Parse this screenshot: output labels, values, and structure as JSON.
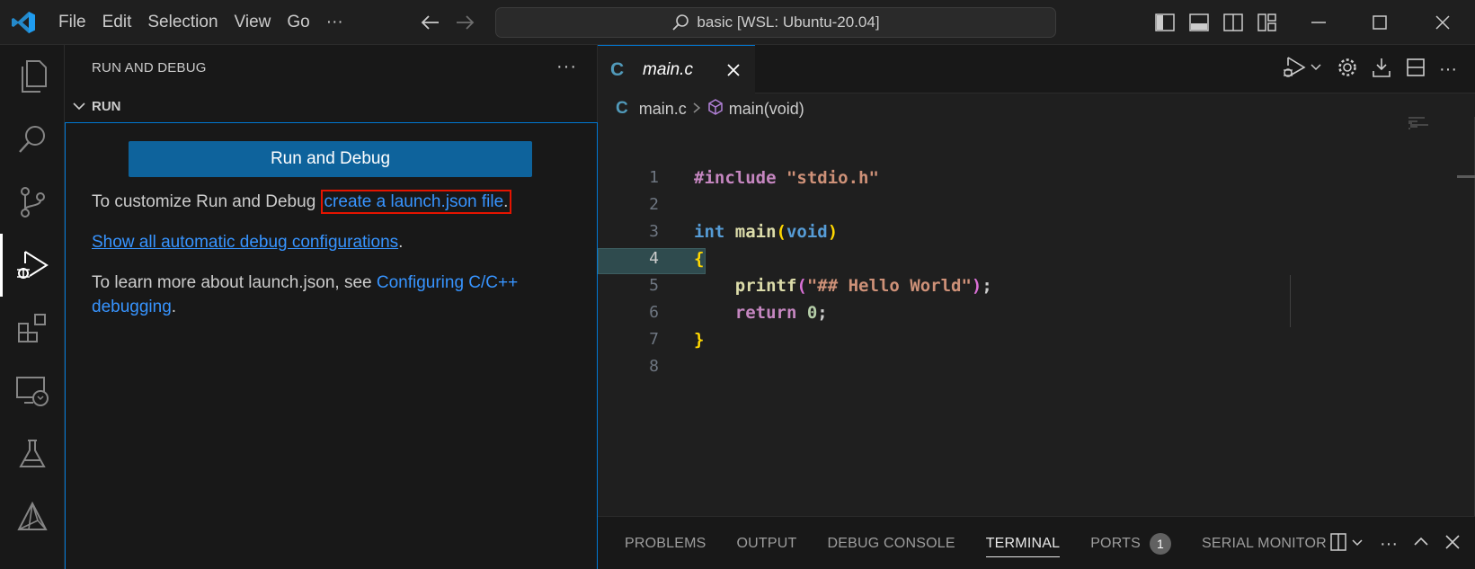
{
  "titlebar": {
    "menu": [
      "File",
      "Edit",
      "Selection",
      "View",
      "Go",
      "···"
    ],
    "command_center": "basic [WSL: Ubuntu-20.04]"
  },
  "sidebar": {
    "title": "RUN AND DEBUG",
    "more": "···",
    "section": "RUN",
    "run_button": "Run and Debug",
    "customize_prefix": "To customize Run and Debug ",
    "create_link": "create a launch.json file",
    "customize_suffix": ".",
    "show_all_link": "Show all automatic debug configurations",
    "show_all_suffix": ".",
    "learn_prefix": "To learn more about launch.json, see ",
    "learn_link": "Configuring C/C++ debugging",
    "learn_suffix": "."
  },
  "editor": {
    "tab": {
      "icon": "C",
      "name": "main.c"
    },
    "breadcrumb": {
      "icon": "C",
      "file": "main.c",
      "symbol": "main(void)"
    },
    "current_line": "4",
    "lines": [
      {
        "num": "1",
        "tokens": [
          [
            "pre",
            "#include "
          ],
          [
            "str",
            "\"stdio.h\""
          ]
        ]
      },
      {
        "num": "2",
        "tokens": []
      },
      {
        "num": "3",
        "tokens": [
          [
            "type",
            "int "
          ],
          [
            "fn",
            "main"
          ],
          [
            "br1",
            "("
          ],
          [
            "type",
            "void"
          ],
          [
            "br1",
            ")"
          ]
        ]
      },
      {
        "num": "4",
        "tokens": [
          [
            "br1",
            "{"
          ]
        ]
      },
      {
        "num": "5",
        "tokens": [
          [
            "plain",
            "    "
          ],
          [
            "fn",
            "printf"
          ],
          [
            "br2",
            "("
          ],
          [
            "str",
            "\"## Hello World\""
          ],
          [
            "br2",
            ")"
          ],
          [
            "plain",
            ";"
          ]
        ]
      },
      {
        "num": "6",
        "tokens": [
          [
            "plain",
            "    "
          ],
          [
            "ret",
            "return "
          ],
          [
            "num",
            "0"
          ],
          [
            "plain",
            ";"
          ]
        ]
      },
      {
        "num": "7",
        "tokens": [
          [
            "br1",
            "}"
          ]
        ]
      },
      {
        "num": "8",
        "tokens": []
      }
    ]
  },
  "panel": {
    "tabs": [
      "PROBLEMS",
      "OUTPUT",
      "DEBUG CONSOLE",
      "TERMINAL",
      "PORTS",
      "SERIAL MONITOR"
    ],
    "active_tab": "TERMINAL",
    "ports_badge": "1"
  },
  "colors": {
    "accent": "#0078d4",
    "button": "#0e639c",
    "link": "#3794ff",
    "highlight_box": "#e51400"
  }
}
